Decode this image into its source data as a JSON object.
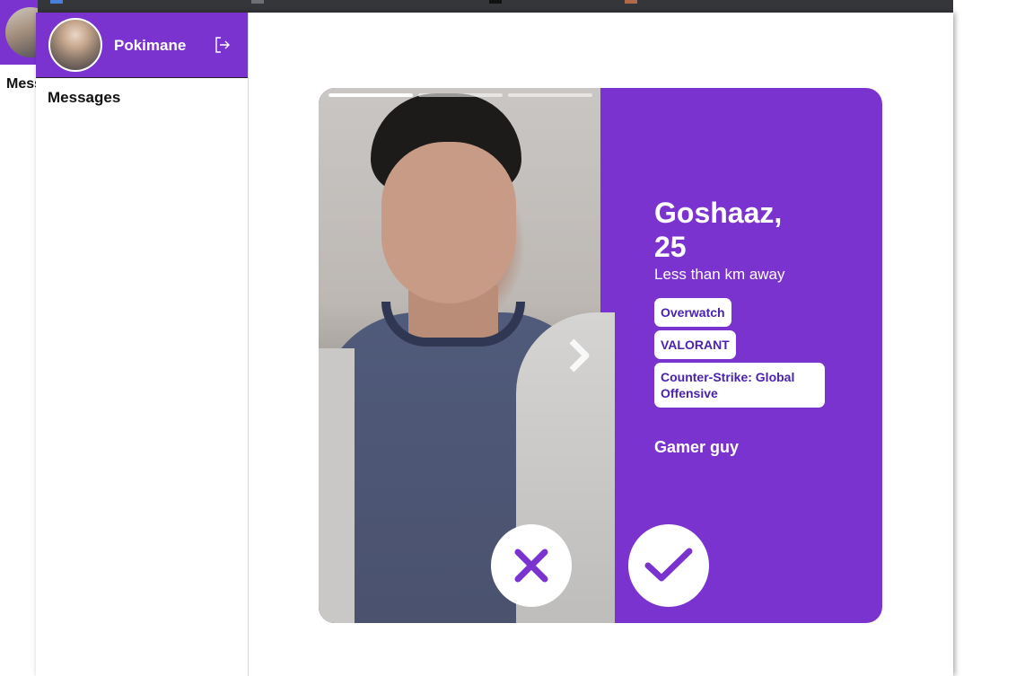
{
  "background_window": {
    "nav_label": "Messages"
  },
  "sidebar": {
    "user_name": "Pokimane",
    "nav": {
      "messages": "Messages"
    }
  },
  "profile": {
    "name_age": "Goshaaz, 25",
    "distance": "Less than km away",
    "games": [
      "Overwatch",
      "VALORANT",
      "Counter-Strike: Global Offensive"
    ],
    "bio": "Gamer guy",
    "photo_count": 3,
    "active_photo_index": 0
  },
  "colors": {
    "accent": "#7b33cf",
    "tag_text": "#4b22b0"
  },
  "icons": {
    "logout": "logout-icon",
    "next": "chevron-right-icon",
    "reject": "close-icon",
    "accept": "check-icon"
  }
}
